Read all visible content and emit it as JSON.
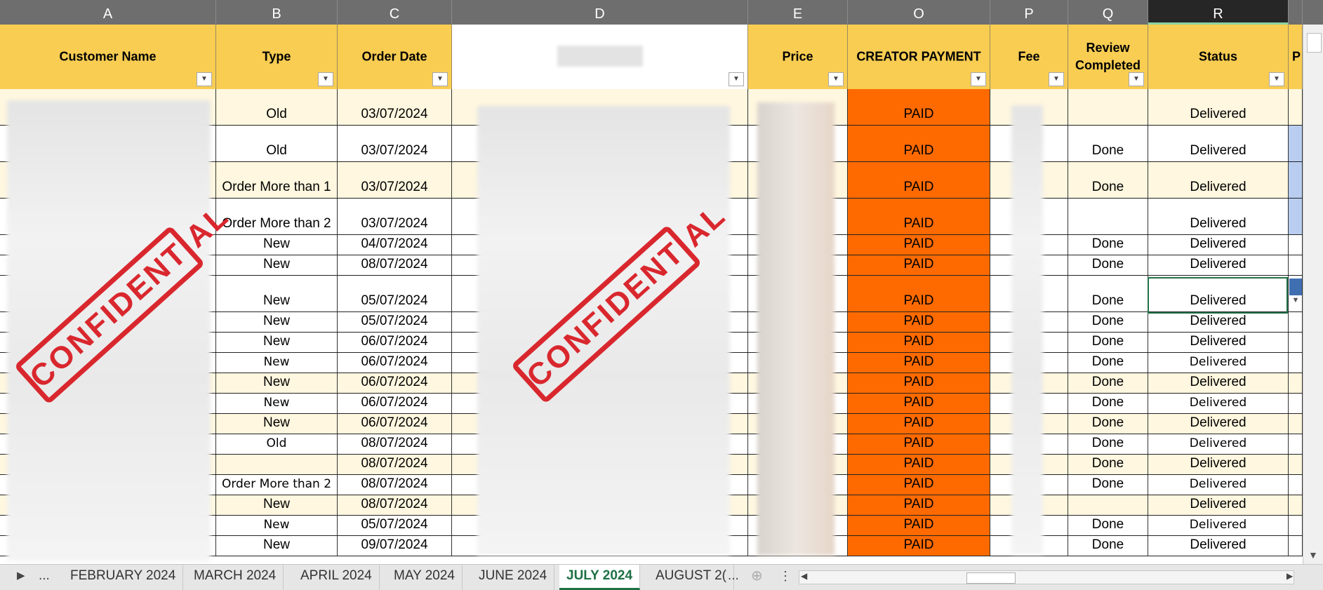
{
  "columns": {
    "letters": [
      "A",
      "B",
      "C",
      "D",
      "E",
      "O",
      "P",
      "Q",
      "R"
    ],
    "selected": "R"
  },
  "headers": {
    "customer_name": "Customer Name",
    "type": "Type",
    "order_date": "Order Date",
    "price": "Price",
    "creator_payment": "CREATOR PAYMENT",
    "fee": "Fee",
    "review_completed": "Review Completed",
    "status": "Status",
    "next_col_partial": "P"
  },
  "stamp_text": "CONFIDENTIAL",
  "rows": [
    {
      "type": "Old",
      "date": "03/07/2024",
      "payment": "PAID",
      "review": "",
      "status": "Delivered"
    },
    {
      "type": "Old",
      "date": "03/07/2024",
      "payment": "PAID",
      "review": "Done",
      "status": "Delivered"
    },
    {
      "type": "Order More than 1",
      "date": "03/07/2024",
      "payment": "PAID",
      "review": "Done",
      "status": "Delivered"
    },
    {
      "type": "Order More than 2",
      "date": "03/07/2024",
      "payment": "PAID",
      "review": "",
      "status": "Delivered"
    },
    {
      "type": "New",
      "date": "04/07/2024",
      "payment": "PAID",
      "review": "Done",
      "status": "Delivered"
    },
    {
      "type": "New",
      "date": "08/07/2024",
      "payment": "PAID",
      "review": "Done",
      "status": "Delivered"
    },
    {
      "type": "New",
      "date": "05/07/2024",
      "payment": "PAID",
      "review": "Done",
      "status": "Delivered"
    },
    {
      "type": "New",
      "date": "05/07/2024",
      "payment": "PAID",
      "review": "Done",
      "status": "Delivered"
    },
    {
      "type": "New",
      "date": "06/07/2024",
      "payment": "PAID",
      "review": "Done",
      "status": "Delivered"
    },
    {
      "type": "New",
      "date": "06/07/2024",
      "payment": "PAID",
      "review": "Done",
      "status": "Delivered"
    },
    {
      "type": "New",
      "date": "06/07/2024",
      "payment": "PAID",
      "review": "Done",
      "status": "Delivered"
    },
    {
      "type": "New",
      "date": "06/07/2024",
      "payment": "PAID",
      "review": "Done",
      "status": "Delivered"
    },
    {
      "type": "New",
      "date": "06/07/2024",
      "payment": "PAID",
      "review": "Done",
      "status": "Delivered"
    },
    {
      "type": "Old",
      "date": "08/07/2024",
      "payment": "PAID",
      "review": "Done",
      "status": "Delivered"
    },
    {
      "type": "",
      "date": "08/07/2024",
      "payment": "PAID",
      "review": "Done",
      "status": "Delivered"
    },
    {
      "type": "Order More than 2",
      "date": "08/07/2024",
      "payment": "PAID",
      "review": "Done",
      "status": "Delivered"
    },
    {
      "type": "New",
      "date": "08/07/2024",
      "payment": "PAID",
      "review": "",
      "status": "Delivered"
    },
    {
      "type": "New",
      "date": "05/07/2024",
      "payment": "PAID",
      "review": "Done",
      "status": "Delivered"
    },
    {
      "type": "New",
      "date": "09/07/2024",
      "payment": "PAID",
      "review": "Done",
      "status": "Delivered"
    }
  ],
  "tabs": {
    "more": "...",
    "items": [
      "FEBRUARY 2024",
      "MARCH 2024",
      "APRIL 2024",
      "MAY 2024",
      "JUNE 2024",
      "JULY 2024",
      "AUGUST 2("
    ],
    "active": "JULY 2024",
    "overflow": "..."
  },
  "colors": {
    "header_yellow": "#f8cd52",
    "paid_orange": "#ff6a00",
    "active_tab": "#1e7145",
    "stamp_red": "#d9272e"
  }
}
